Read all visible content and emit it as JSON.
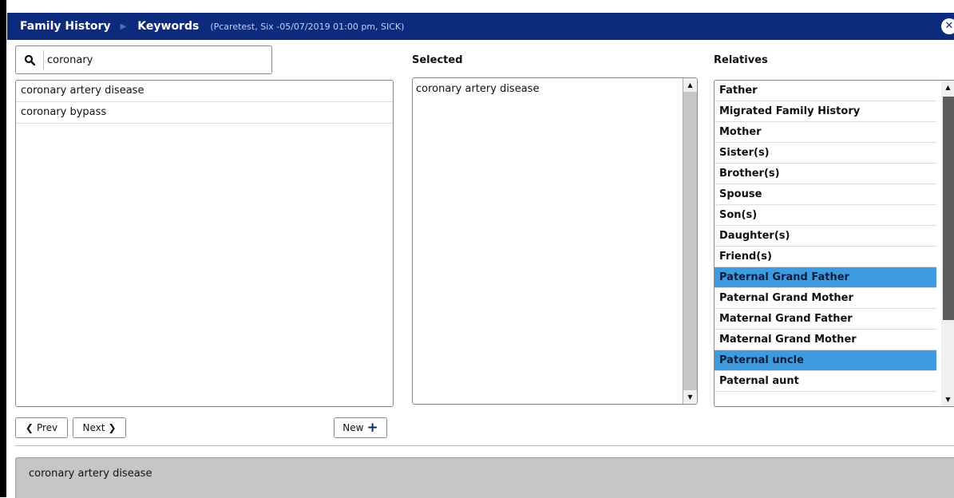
{
  "titlebar": {
    "crumb1": "Family History",
    "crumb2": "Keywords",
    "context": "(Pcaretest, Six -05/07/2019 01:00 pm, SICK)",
    "close_icon": "✕"
  },
  "search": {
    "value": "coronary"
  },
  "results": [
    "coronary artery disease",
    "coronary bypass"
  ],
  "selected": {
    "label": "Selected",
    "items": [
      "coronary artery disease"
    ]
  },
  "relatives": {
    "label": "Relatives",
    "items": [
      {
        "name": "Father",
        "selected": false
      },
      {
        "name": "Migrated Family History",
        "selected": false
      },
      {
        "name": "Mother",
        "selected": false
      },
      {
        "name": "Sister(s)",
        "selected": false
      },
      {
        "name": "Brother(s)",
        "selected": false
      },
      {
        "name": "Spouse",
        "selected": false
      },
      {
        "name": "Son(s)",
        "selected": false
      },
      {
        "name": "Daughter(s)",
        "selected": false
      },
      {
        "name": "Friend(s)",
        "selected": false
      },
      {
        "name": "Paternal Grand Father",
        "selected": true
      },
      {
        "name": "Paternal Grand Mother",
        "selected": false
      },
      {
        "name": "Maternal Grand Father",
        "selected": false
      },
      {
        "name": "Maternal Grand Mother",
        "selected": false
      },
      {
        "name": "Paternal uncle",
        "selected": true
      },
      {
        "name": "Paternal aunt",
        "selected": false
      }
    ],
    "selected_color": "#3e9be0"
  },
  "pager": {
    "prev": "Prev",
    "next": "Next",
    "new": "New"
  },
  "description": "coronary artery disease",
  "colors": {
    "header": "#0d2b7d",
    "panel_gray": "#c6c6c6"
  }
}
